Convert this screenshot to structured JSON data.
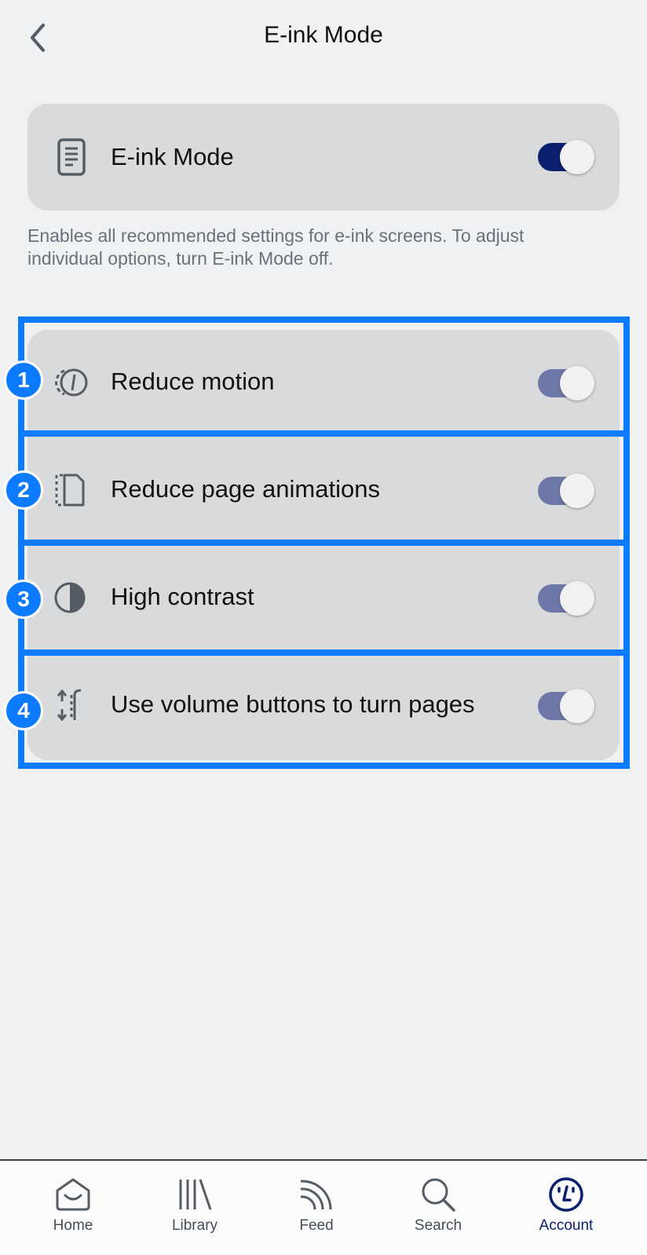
{
  "header": {
    "title": "E-ink Mode"
  },
  "master": {
    "label": "E-ink Mode",
    "toggle_on": true
  },
  "description": "Enables all recommended settings for e-ink screens. To adjust individual options, turn E-ink Mode off.",
  "options": [
    {
      "label": "Reduce motion",
      "badge": "1",
      "toggle_on": true,
      "icon": "reduce-motion-icon"
    },
    {
      "label": "Reduce page animations",
      "badge": "2",
      "toggle_on": true,
      "icon": "page-animation-icon"
    },
    {
      "label": "High contrast",
      "badge": "3",
      "toggle_on": true,
      "icon": "contrast-icon"
    },
    {
      "label": "Use volume buttons to turn pages",
      "badge": "4",
      "toggle_on": true,
      "icon": "volume-buttons-icon"
    }
  ],
  "nav": {
    "items": [
      {
        "label": "Home",
        "icon": "home-icon"
      },
      {
        "label": "Library",
        "icon": "library-icon"
      },
      {
        "label": "Feed",
        "icon": "feed-icon"
      },
      {
        "label": "Search",
        "icon": "search-icon"
      },
      {
        "label": "Account",
        "icon": "account-icon",
        "active": true
      }
    ]
  },
  "colors": {
    "background": "#eff1f3",
    "card": "#d9dadb",
    "toggle_on_master": "#0b1f6e",
    "toggle_on_disabled": "#6e78a8",
    "highlight": "#0d7bff",
    "nav_active": "#0b1f6e"
  }
}
